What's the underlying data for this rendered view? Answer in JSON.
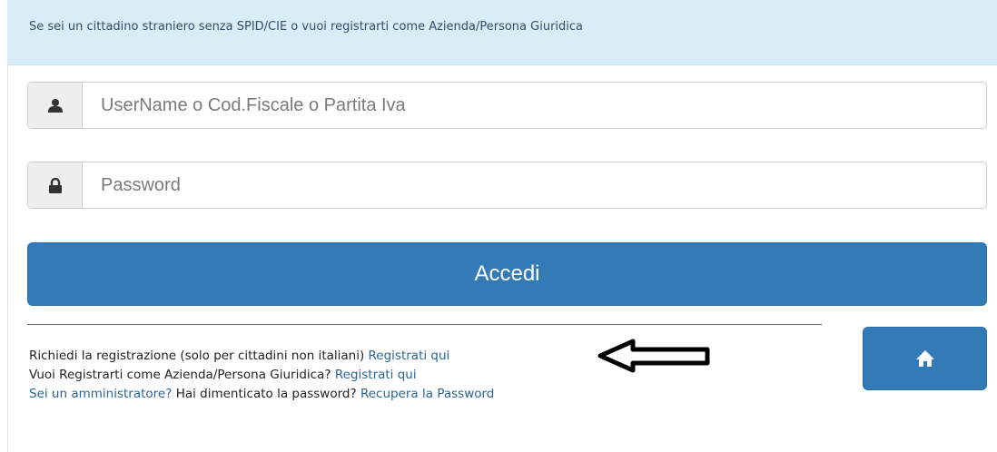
{
  "banner": {
    "text": "Se sei un cittadino straniero senza SPID/CIE o vuoi registrarti come Azienda/Persona Giuridica"
  },
  "form": {
    "username_placeholder": "UserName o Cod.Fiscale o Partita Iva",
    "username_icon": "user-icon",
    "password_placeholder": "Password",
    "password_icon": "lock-icon",
    "login_label": "Accedi"
  },
  "links": {
    "line1_text": "Richiedi la registrazione (solo per cittadini non italiani)",
    "line1_link": "Registrati qui",
    "line2_text": "Vuoi Registrarti come Azienda/Persona Giuridica?",
    "line2_link": "Registrati qui",
    "line3_link_admin": "Sei un amministratore?",
    "line3_text": "Hai dimenticato la password?",
    "line3_link_recover": "Recupera la Password"
  },
  "home_button": {
    "icon": "home-icon"
  },
  "annotation": {
    "icon": "left-arrow-annotation"
  },
  "colors": {
    "primary": "#337ab7",
    "banner_bg": "#d9edf7",
    "link": "#2a6496"
  }
}
